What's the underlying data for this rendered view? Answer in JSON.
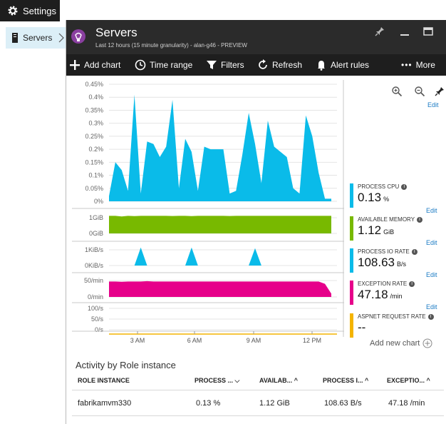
{
  "settings_tab": {
    "label": "Settings",
    "icon": "gear-icon"
  },
  "breadcrumb": {
    "label": "Servers",
    "icon": "server-icon"
  },
  "blade": {
    "title": "Servers",
    "subtitle": "Last 12 hours (15 minute granularity) - alan-g46 - PREVIEW"
  },
  "commands": {
    "add_chart": "Add chart",
    "time_range": "Time range",
    "filters": "Filters",
    "refresh": "Refresh",
    "alert_rules": "Alert rules",
    "more": "More"
  },
  "chart_data": {
    "type": "area",
    "x_ticks": [
      "3 AM",
      "6 AM",
      "9 AM",
      "12 PM"
    ],
    "series": [
      {
        "name": "PROCESS CPU",
        "color": "#0abbe9",
        "y_ticks": [
          "0.45%",
          "0.4%",
          "0.35%",
          "0.3%",
          "0.25%",
          "0.2%",
          "0.15%",
          "0.1%",
          "0.05%",
          "0%"
        ],
        "ylim": [
          0,
          0.45
        ],
        "values": [
          0.02,
          0.15,
          0.12,
          0.04,
          0.41,
          0.03,
          0.23,
          0.22,
          0.17,
          0.21,
          0.39,
          0.05,
          0.24,
          0.19,
          0.04,
          0.21,
          0.2,
          0.2,
          0.2,
          0.03,
          0.04,
          0.18,
          0.34,
          0.22,
          0.07,
          0.31,
          0.21,
          0.19,
          0.17,
          0.05,
          0.03,
          0.33,
          0.25,
          0.11,
          0.01,
          0.01
        ]
      },
      {
        "name": "AVAILABLE MEMORY",
        "color": "#78b900",
        "y_ticks": [
          "1GiB",
          "0GiB"
        ],
        "values": [
          1.12,
          1.12,
          1.08,
          1.12,
          1.1,
          1.12,
          1.12,
          1.12,
          1.12,
          1.12,
          1.11,
          1.12,
          1.12,
          1.1,
          1.12,
          1.12,
          1.12,
          1.12,
          1.12,
          1.11,
          1.12,
          1.12,
          1.12,
          1.12,
          1.12,
          1.12,
          1.12,
          1.12,
          1.12,
          1.12,
          1.12,
          1.12,
          1.12,
          1.12,
          1.12,
          1.12
        ]
      },
      {
        "name": "PROCESS IO RATE",
        "color": "#0abbe9",
        "y_ticks": [
          "1KiB/s",
          "0KiB/s"
        ],
        "values": [
          0,
          0,
          0,
          0,
          0,
          1.3,
          0,
          0,
          0,
          0,
          0,
          0,
          0,
          1.2,
          0,
          0,
          0,
          0,
          0,
          0,
          0,
          0,
          0,
          1.1,
          0,
          0,
          0,
          0,
          0,
          0,
          0,
          0,
          0,
          0,
          0,
          0
        ]
      },
      {
        "name": "EXCEPTION RATE",
        "color": "#e6008a",
        "y_ticks": [
          "50/min",
          "0/min"
        ],
        "values": [
          47,
          47,
          46,
          47,
          47,
          47,
          48,
          47,
          47,
          47,
          47,
          47,
          47,
          47,
          47,
          47,
          47,
          47,
          47,
          47,
          47,
          47,
          47,
          47,
          47,
          47,
          47,
          47,
          47,
          47,
          47,
          47,
          47,
          47,
          40,
          10
        ]
      },
      {
        "name": "ASPNET REQUEST RATE",
        "color": "#f4b400",
        "y_ticks": [
          "100/s",
          "50/s",
          "0/s"
        ],
        "values": []
      }
    ]
  },
  "metrics": [
    {
      "name": "PROCESS CPU",
      "value": "0.13",
      "unit": "%",
      "color": "#0abbe9",
      "edit": "Edit"
    },
    {
      "name": "AVAILABLE MEMORY",
      "value": "1.12",
      "unit": "GiB",
      "color": "#78b900",
      "edit": "Edit"
    },
    {
      "name": "PROCESS IO RATE",
      "value": "108.63",
      "unit": "B/s",
      "color": "#0abbe9",
      "edit": "Edit"
    },
    {
      "name": "EXCEPTION RATE",
      "value": "47.18",
      "unit": "/min",
      "color": "#e6008a",
      "edit": "Edit"
    },
    {
      "name": "ASPNET REQUEST RATE",
      "value": "--",
      "unit": "",
      "color": "#f4b400",
      "edit": "Edit"
    }
  ],
  "top_edit": "Edit",
  "add_new_chart": "Add new chart",
  "activity": {
    "title": "Activity by Role instance",
    "columns": [
      "ROLE INSTANCE",
      "PROCESS ...",
      "AVAILAB...",
      "PROCESS I...",
      "EXCEPTIO..."
    ],
    "rows": [
      [
        "fabrikamvm330",
        "0.13 %",
        "1.12 GiB",
        "108.63 B/s",
        "47.18 /min"
      ]
    ]
  }
}
